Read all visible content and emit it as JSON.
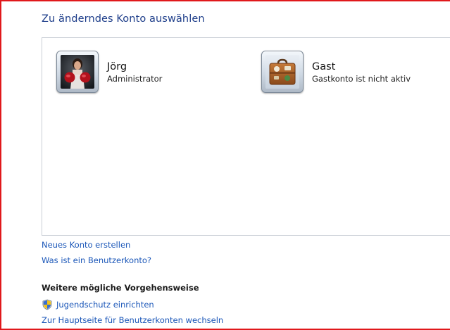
{
  "page": {
    "title": "Zu änderndes Konto auswählen"
  },
  "accounts": [
    {
      "name": "Jörg",
      "subtitle": "Administrator",
      "avatar_icon": "boxer-avatar-icon"
    },
    {
      "name": "Gast",
      "subtitle": "Gastkonto ist nicht aktiv",
      "avatar_icon": "suitcase-avatar-icon"
    }
  ],
  "links": {
    "new_account": "Neues Konto erstellen",
    "what_is_account": "Was ist ein Benutzerkonto?"
  },
  "more_tasks": {
    "heading": "Weitere mögliche Vorgehensweise",
    "parental_controls": "Jugendschutz einrichten",
    "parental_controls_icon": "uac-shield-icon",
    "main_page": "Zur Hauptseite für Benutzerkonten wechseln"
  },
  "colors": {
    "title": "#1e3e8a",
    "link": "#1a56b8",
    "frame_border": "#e0181c"
  }
}
